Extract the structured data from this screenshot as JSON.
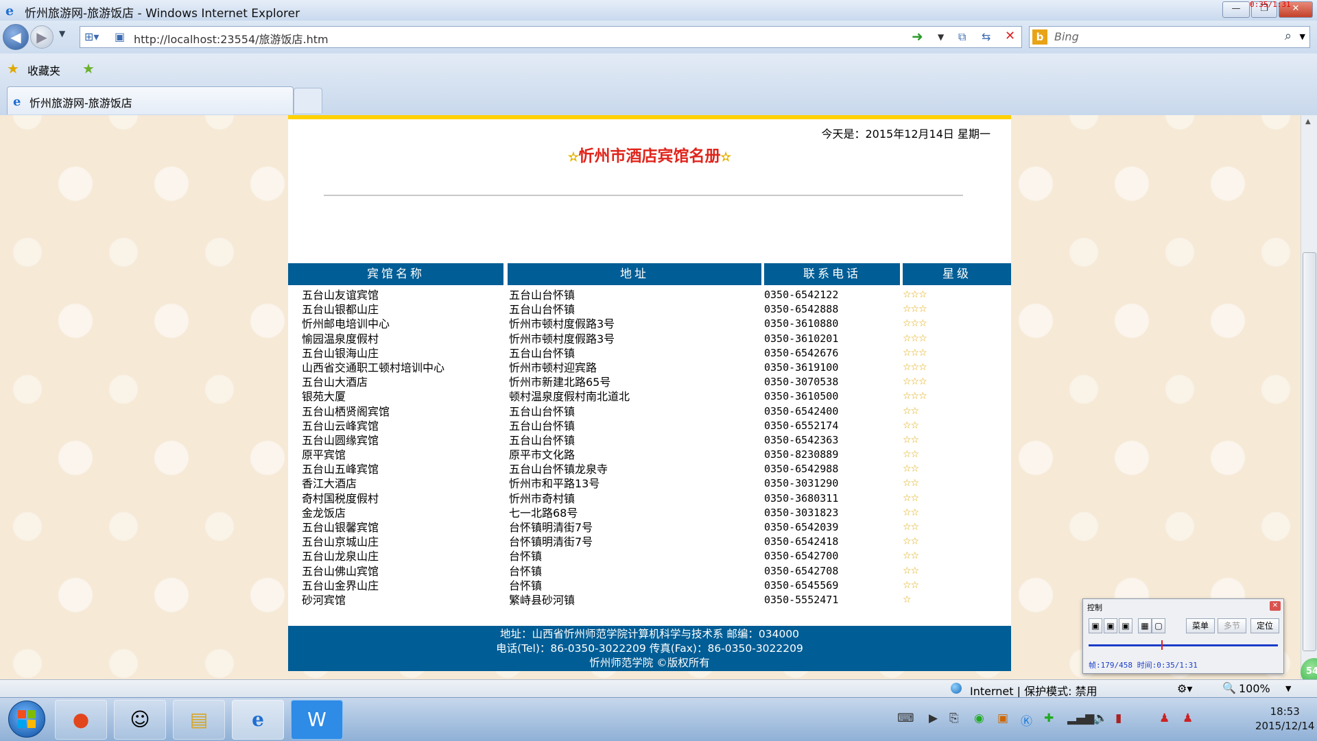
{
  "window": {
    "title": "忻州旅游网-旅游饭店 - Windows Internet Explorer",
    "overlay_time": "0:35/1:31"
  },
  "nav": {
    "url": "http://localhost:23554/旅游饭店.htm",
    "search_placeholder": "Bing"
  },
  "favbar": {
    "favorites_label": "收藏夹"
  },
  "tab": {
    "title": "忻州旅游网-旅游饭店"
  },
  "page": {
    "date": "今天是：2015年12月14日 星期一",
    "heading": "忻州市酒店宾馆名册",
    "table": {
      "headers": [
        "宾馆名称",
        "地址",
        "联系电话",
        "星级"
      ],
      "rows": [
        {
          "name": "五台山友谊宾馆",
          "addr": "五台山台怀镇",
          "tel": "0350-6542122",
          "stars": "☆☆☆"
        },
        {
          "name": "五台山银都山庄",
          "addr": "五台山台怀镇",
          "tel": "0350-6542888",
          "stars": "☆☆☆"
        },
        {
          "name": "忻州邮电培训中心",
          "addr": "忻州市顿村度假路3号",
          "tel": "0350-3610880",
          "stars": "☆☆☆"
        },
        {
          "name": "愉园温泉度假村",
          "addr": "忻州市顿村度假路3号",
          "tel": "0350-3610201",
          "stars": "☆☆☆"
        },
        {
          "name": "五台山银海山庄",
          "addr": "五台山台怀镇",
          "tel": "0350-6542676",
          "stars": "☆☆☆"
        },
        {
          "name": "山西省交通职工顿村培训中心",
          "addr": "忻州市顿村迎宾路",
          "tel": "0350-3619100",
          "stars": "☆☆☆"
        },
        {
          "name": "五台山大酒店",
          "addr": "忻州市新建北路65号",
          "tel": "0350-3070538",
          "stars": "☆☆☆"
        },
        {
          "name": "银苑大厦",
          "addr": "顿村温泉度假村南北道北",
          "tel": "0350-3610500",
          "stars": "☆☆☆"
        },
        {
          "name": "五台山栖贤阁宾馆",
          "addr": "五台山台怀镇",
          "tel": "0350-6542400",
          "stars": "☆☆"
        },
        {
          "name": "五台山云峰宾馆",
          "addr": "五台山台怀镇",
          "tel": "0350-6552174",
          "stars": "☆☆"
        },
        {
          "name": "五台山圆缘宾馆",
          "addr": "五台山台怀镇",
          "tel": "0350-6542363",
          "stars": "☆☆"
        },
        {
          "name": "原平宾馆",
          "addr": "原平市文化路",
          "tel": "0350-8230889",
          "stars": "☆☆"
        },
        {
          "name": "五台山五峰宾馆",
          "addr": "五台山台怀镇龙泉寺",
          "tel": "0350-6542988",
          "stars": "☆☆"
        },
        {
          "name": "香江大酒店",
          "addr": "忻州市和平路13号",
          "tel": "0350-3031290",
          "stars": "☆☆"
        },
        {
          "name": "奇村国税度假村",
          "addr": "忻州市奇村镇",
          "tel": "0350-3680311",
          "stars": "☆☆"
        },
        {
          "name": "金龙饭店",
          "addr": "七一北路68号",
          "tel": "0350-3031823",
          "stars": "☆☆"
        },
        {
          "name": "五台山银馨宾馆",
          "addr": "台怀镇明清街7号",
          "tel": "0350-6542039",
          "stars": "☆☆"
        },
        {
          "name": "五台山京城山庄",
          "addr": "台怀镇明清街7号",
          "tel": "0350-6542418",
          "stars": "☆☆"
        },
        {
          "name": "五台山龙泉山庄",
          "addr": "台怀镇",
          "tel": "0350-6542700",
          "stars": "☆☆"
        },
        {
          "name": "五台山佛山宾馆",
          "addr": "台怀镇",
          "tel": "0350-6542708",
          "stars": "☆☆"
        },
        {
          "name": "五台山金界山庄",
          "addr": "台怀镇",
          "tel": "0350-6545569",
          "stars": "☆☆"
        },
        {
          "name": "砂河宾馆",
          "addr": "繁峙县砂河镇",
          "tel": "0350-5552471",
          "stars": "☆"
        }
      ]
    },
    "footer": {
      "line1": "地址：山西省忻州师范学院计算机科学与技术系  邮编：034000",
      "line2": "电话(Tel)：86-0350-3022209   传真(Fax)：86-0350-3022209",
      "line3": "忻州师范学院 ©版权所有"
    }
  },
  "control_panel": {
    "title": "控制",
    "menu_label": "菜单",
    "multi_label": "多节",
    "locate_label": "定位",
    "info": "帧:179/458 时间:0:35/1:31"
  },
  "status": {
    "zone": "Internet | 保护模式: 禁用",
    "zoom": "100%"
  },
  "tray_badge": "54",
  "clock": {
    "time": "18:53",
    "date": "2015/12/14"
  }
}
